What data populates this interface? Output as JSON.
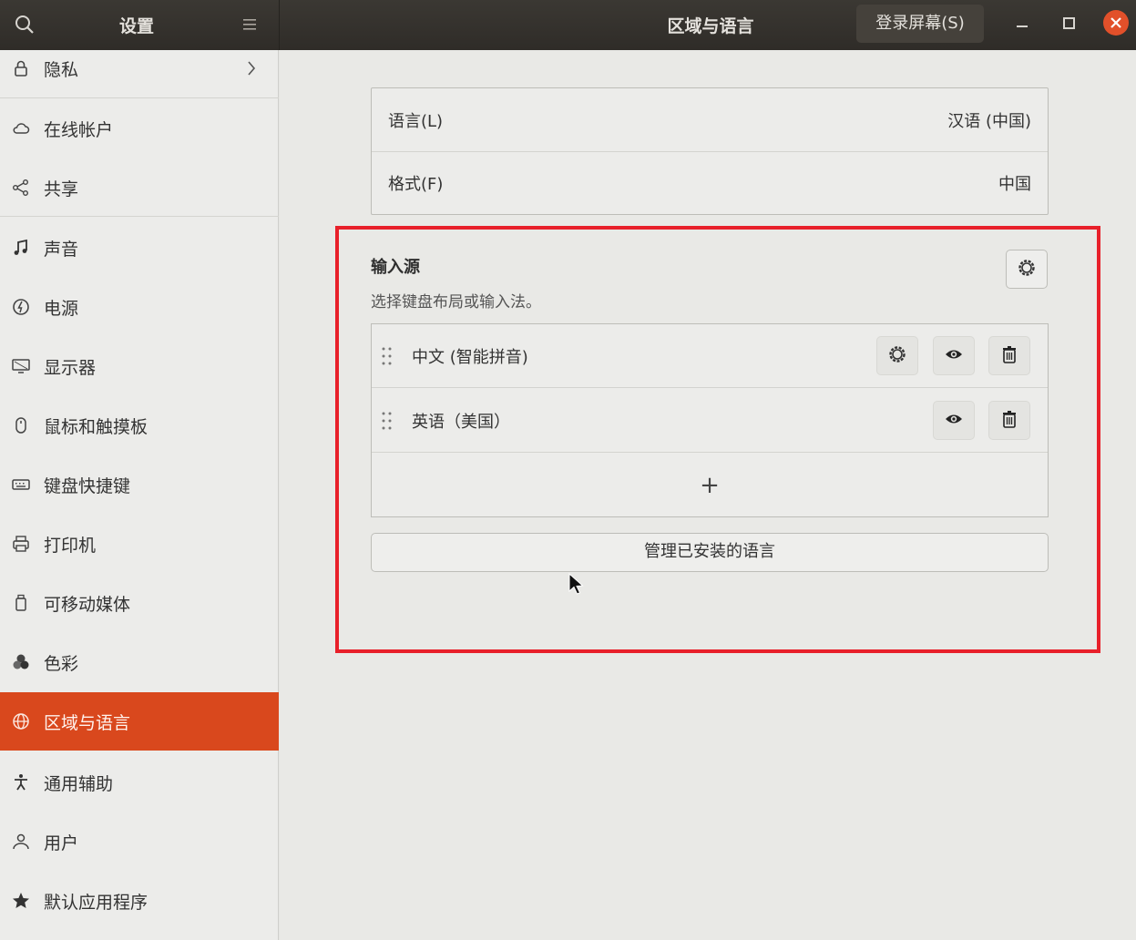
{
  "header": {
    "left_title": "设置",
    "center_title": "区域与语言",
    "login_screen_button": "登录屏幕(S)"
  },
  "sidebar": {
    "items": [
      {
        "label": "隐私",
        "icon": "lock-icon"
      },
      {
        "label": "在线帐户",
        "icon": "cloud-icon"
      },
      {
        "label": "共享",
        "icon": "share-icon"
      },
      {
        "label": "声音",
        "icon": "music-note-icon"
      },
      {
        "label": "电源",
        "icon": "power-icon"
      },
      {
        "label": "显示器",
        "icon": "monitor-icon"
      },
      {
        "label": "鼠标和触摸板",
        "icon": "mouse-icon"
      },
      {
        "label": "键盘快捷键",
        "icon": "keyboard-icon"
      },
      {
        "label": "打印机",
        "icon": "printer-icon"
      },
      {
        "label": "可移动媒体",
        "icon": "usb-drive-icon"
      },
      {
        "label": "色彩",
        "icon": "color-icon"
      },
      {
        "label": "区域与语言",
        "icon": "globe-icon",
        "active": true
      },
      {
        "label": "通用辅助",
        "icon": "accessibility-icon"
      },
      {
        "label": "用户",
        "icon": "user-icon"
      },
      {
        "label": "默认应用程序",
        "icon": "star-icon"
      }
    ]
  },
  "language": {
    "language_label": "语言(L)",
    "language_value": "汉语 (中国)",
    "format_label": "格式(F)",
    "format_value": "中国"
  },
  "input_sources": {
    "title": "输入源",
    "subtitle": "选择键盘布局或输入法。",
    "sources": [
      {
        "label": "中文 (智能拼音)"
      },
      {
        "label": "英语（美国）"
      }
    ],
    "add_label": "+",
    "manage_button": "管理已安装的语言"
  },
  "colors": {
    "accent": "#d9481d",
    "highlight": "#e8202a",
    "headerbar": "#2f2c28"
  }
}
